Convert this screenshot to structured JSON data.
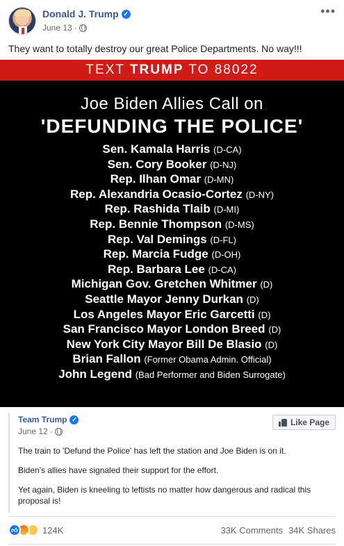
{
  "post": {
    "author": "Donald J. Trump",
    "date": "June 13",
    "separator": "·",
    "more_icon": "more-horizontal-icon",
    "text": "They want to totally destroy our great Police Departments. No way!!!"
  },
  "image": {
    "banner_prefix": "TEXT ",
    "banner_bold": "TRUMP",
    "banner_suffix": " TO 88022",
    "headline_line1": "Joe Biden Allies Call on",
    "headline_line2": "'DEFUNDING THE POLICE'",
    "names": [
      {
        "name": "Sen. Kamala Harris",
        "note": "(D-CA)"
      },
      {
        "name": "Sen. Cory Booker",
        "note": "(D-NJ)"
      },
      {
        "name": "Rep. Ilhan Omar",
        "note": "(D-MN)"
      },
      {
        "name": "Rep. Alexandria Ocasio-Cortez",
        "note": "(D-NY)"
      },
      {
        "name": "Rep. Rashida Tlaib",
        "note": "(D-MI)"
      },
      {
        "name": "Rep. Bennie Thompson",
        "note": "(D-MS)"
      },
      {
        "name": "Rep. Val Demings",
        "note": "(D-FL)"
      },
      {
        "name": "Rep. Marcia Fudge",
        "note": "(D-OH)"
      },
      {
        "name": "Rep. Barbara Lee",
        "note": "(D-CA)"
      },
      {
        "name": "Michigan Gov. Gretchen Whitmer",
        "note": "(D)"
      },
      {
        "name": "Seattle Mayor Jenny Durkan",
        "note": "(D)"
      },
      {
        "name": "Los Angeles Mayor Eric Garcetti",
        "note": "(D)"
      },
      {
        "name": "San Francisco Mayor London Breed",
        "note": "(D)"
      },
      {
        "name": "New York City Mayor Bill De Blasio",
        "note": "(D)"
      },
      {
        "name": "Brian Fallon",
        "note": "(Former Obama Admin. Official)"
      },
      {
        "name": "John Legend",
        "note": "(Bad Performer and Biden Surrogate)"
      }
    ]
  },
  "shared": {
    "page_name": "Team Trump",
    "date": "June 12",
    "separator": "·",
    "like_page_label": "Like Page",
    "paragraphs": [
      "The train to 'Defund the Police' has left the station and Joe Biden is on it.",
      "Biden's allies have signaled their support for the effort.",
      "Yet again, Biden is kneeling to leftists no matter how dangerous and radical this proposal is!"
    ]
  },
  "footer": {
    "reaction_count": "124K",
    "comments": "33K Comments",
    "shares": "34K Shares"
  },
  "colors": {
    "link_blue": "#385898",
    "verified_blue": "#1877f2",
    "banner_red": "#d01b17"
  }
}
